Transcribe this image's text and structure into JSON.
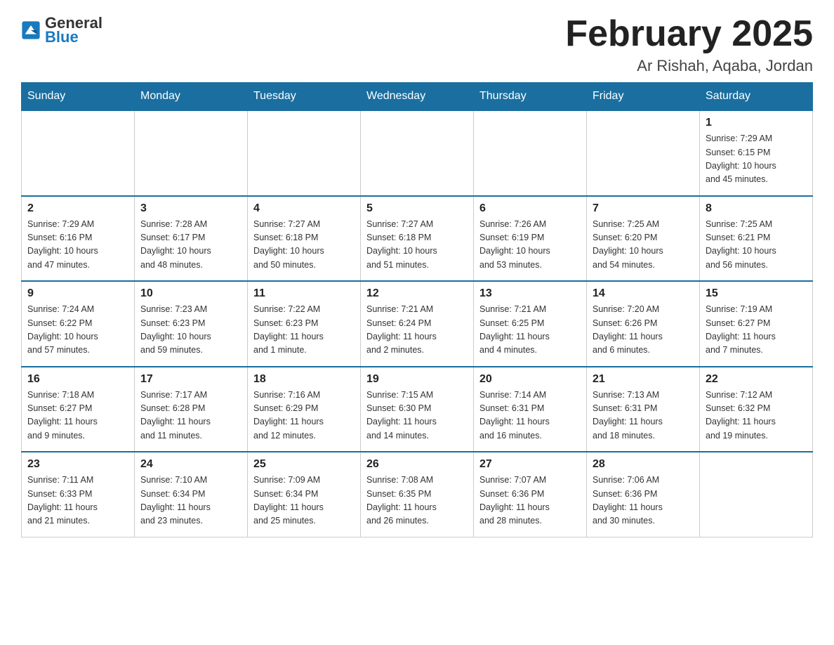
{
  "logo": {
    "text_general": "General",
    "text_blue": "Blue"
  },
  "title": "February 2025",
  "location": "Ar Rishah, Aqaba, Jordan",
  "days_of_week": [
    "Sunday",
    "Monday",
    "Tuesday",
    "Wednesday",
    "Thursday",
    "Friday",
    "Saturday"
  ],
  "weeks": [
    [
      {
        "day": "",
        "info": ""
      },
      {
        "day": "",
        "info": ""
      },
      {
        "day": "",
        "info": ""
      },
      {
        "day": "",
        "info": ""
      },
      {
        "day": "",
        "info": ""
      },
      {
        "day": "",
        "info": ""
      },
      {
        "day": "1",
        "info": "Sunrise: 7:29 AM\nSunset: 6:15 PM\nDaylight: 10 hours\nand 45 minutes."
      }
    ],
    [
      {
        "day": "2",
        "info": "Sunrise: 7:29 AM\nSunset: 6:16 PM\nDaylight: 10 hours\nand 47 minutes."
      },
      {
        "day": "3",
        "info": "Sunrise: 7:28 AM\nSunset: 6:17 PM\nDaylight: 10 hours\nand 48 minutes."
      },
      {
        "day": "4",
        "info": "Sunrise: 7:27 AM\nSunset: 6:18 PM\nDaylight: 10 hours\nand 50 minutes."
      },
      {
        "day": "5",
        "info": "Sunrise: 7:27 AM\nSunset: 6:18 PM\nDaylight: 10 hours\nand 51 minutes."
      },
      {
        "day": "6",
        "info": "Sunrise: 7:26 AM\nSunset: 6:19 PM\nDaylight: 10 hours\nand 53 minutes."
      },
      {
        "day": "7",
        "info": "Sunrise: 7:25 AM\nSunset: 6:20 PM\nDaylight: 10 hours\nand 54 minutes."
      },
      {
        "day": "8",
        "info": "Sunrise: 7:25 AM\nSunset: 6:21 PM\nDaylight: 10 hours\nand 56 minutes."
      }
    ],
    [
      {
        "day": "9",
        "info": "Sunrise: 7:24 AM\nSunset: 6:22 PM\nDaylight: 10 hours\nand 57 minutes."
      },
      {
        "day": "10",
        "info": "Sunrise: 7:23 AM\nSunset: 6:23 PM\nDaylight: 10 hours\nand 59 minutes."
      },
      {
        "day": "11",
        "info": "Sunrise: 7:22 AM\nSunset: 6:23 PM\nDaylight: 11 hours\nand 1 minute."
      },
      {
        "day": "12",
        "info": "Sunrise: 7:21 AM\nSunset: 6:24 PM\nDaylight: 11 hours\nand 2 minutes."
      },
      {
        "day": "13",
        "info": "Sunrise: 7:21 AM\nSunset: 6:25 PM\nDaylight: 11 hours\nand 4 minutes."
      },
      {
        "day": "14",
        "info": "Sunrise: 7:20 AM\nSunset: 6:26 PM\nDaylight: 11 hours\nand 6 minutes."
      },
      {
        "day": "15",
        "info": "Sunrise: 7:19 AM\nSunset: 6:27 PM\nDaylight: 11 hours\nand 7 minutes."
      }
    ],
    [
      {
        "day": "16",
        "info": "Sunrise: 7:18 AM\nSunset: 6:27 PM\nDaylight: 11 hours\nand 9 minutes."
      },
      {
        "day": "17",
        "info": "Sunrise: 7:17 AM\nSunset: 6:28 PM\nDaylight: 11 hours\nand 11 minutes."
      },
      {
        "day": "18",
        "info": "Sunrise: 7:16 AM\nSunset: 6:29 PM\nDaylight: 11 hours\nand 12 minutes."
      },
      {
        "day": "19",
        "info": "Sunrise: 7:15 AM\nSunset: 6:30 PM\nDaylight: 11 hours\nand 14 minutes."
      },
      {
        "day": "20",
        "info": "Sunrise: 7:14 AM\nSunset: 6:31 PM\nDaylight: 11 hours\nand 16 minutes."
      },
      {
        "day": "21",
        "info": "Sunrise: 7:13 AM\nSunset: 6:31 PM\nDaylight: 11 hours\nand 18 minutes."
      },
      {
        "day": "22",
        "info": "Sunrise: 7:12 AM\nSunset: 6:32 PM\nDaylight: 11 hours\nand 19 minutes."
      }
    ],
    [
      {
        "day": "23",
        "info": "Sunrise: 7:11 AM\nSunset: 6:33 PM\nDaylight: 11 hours\nand 21 minutes."
      },
      {
        "day": "24",
        "info": "Sunrise: 7:10 AM\nSunset: 6:34 PM\nDaylight: 11 hours\nand 23 minutes."
      },
      {
        "day": "25",
        "info": "Sunrise: 7:09 AM\nSunset: 6:34 PM\nDaylight: 11 hours\nand 25 minutes."
      },
      {
        "day": "26",
        "info": "Sunrise: 7:08 AM\nSunset: 6:35 PM\nDaylight: 11 hours\nand 26 minutes."
      },
      {
        "day": "27",
        "info": "Sunrise: 7:07 AM\nSunset: 6:36 PM\nDaylight: 11 hours\nand 28 minutes."
      },
      {
        "day": "28",
        "info": "Sunrise: 7:06 AM\nSunset: 6:36 PM\nDaylight: 11 hours\nand 30 minutes."
      },
      {
        "day": "",
        "info": ""
      }
    ]
  ]
}
